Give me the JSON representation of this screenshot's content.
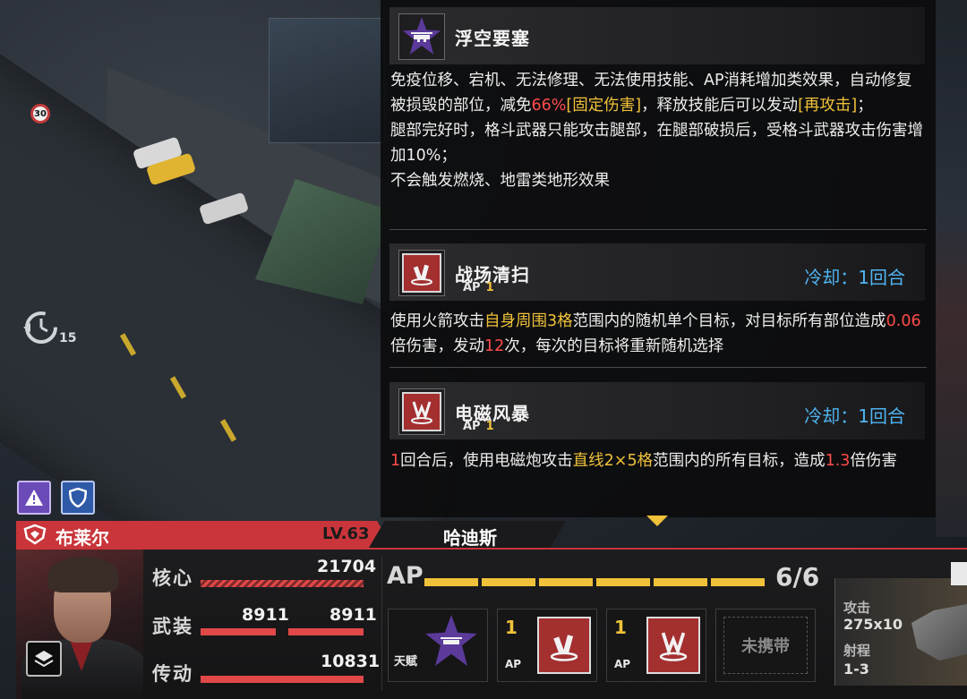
{
  "tooltip": {
    "skill1": {
      "name": "浮空要塞",
      "desc": [
        {
          "t": "免疫位移、宕机、无法修理、无法使用技能、AP消耗增加类效果，自动修复被损毁的部位，减免",
          "c": ""
        },
        {
          "t": "66%",
          "c": "red"
        },
        {
          "t": "[固定伤害]",
          "c": "yel"
        },
        {
          "t": "，释放技能后可以发动",
          "c": ""
        },
        {
          "t": "[再攻击]",
          "c": "yel"
        },
        {
          "t": "；",
          "c": ""
        },
        {
          "t": "\n腿部完好时，格斗武器只能攻击腿部，在腿部破损后，受格斗武器攻击伤害增加10%；",
          "c": ""
        },
        {
          "t": "\n不会触发燃烧、地雷类地形效果",
          "c": ""
        }
      ]
    },
    "skill2": {
      "name": "战场清扫",
      "ap_label": "AP",
      "ap_value": "1",
      "cooldown": "冷却：1回合",
      "desc": [
        {
          "t": "使用火箭攻击",
          "c": ""
        },
        {
          "t": "自身周围3格",
          "c": "yel"
        },
        {
          "t": "范围内的随机单个目标，对目标所有部位造成",
          "c": ""
        },
        {
          "t": "0.06",
          "c": "red"
        },
        {
          "t": "倍伤害，发动",
          "c": ""
        },
        {
          "t": "12",
          "c": "red"
        },
        {
          "t": "次，每次的目标将重新随机选择",
          "c": ""
        }
      ]
    },
    "skill3": {
      "name": "电磁风暴",
      "ap_label": "AP",
      "ap_value": "1",
      "cooldown": "冷却：1回合",
      "desc": [
        {
          "t": "1",
          "c": "red"
        },
        {
          "t": "回合后，使用电磁炮攻击",
          "c": ""
        },
        {
          "t": "直线2×5格",
          "c": "yel"
        },
        {
          "t": "范围内的所有目标，造成",
          "c": ""
        },
        {
          "t": "1.3",
          "c": "red"
        },
        {
          "t": "倍伤害",
          "c": ""
        }
      ]
    }
  },
  "scene": {
    "speed_sign": "30",
    "timer_value": "15"
  },
  "unit": {
    "pilot_name": "布莱尔",
    "level": "LV.63",
    "mech_name": "哈迪斯",
    "stats": {
      "core_label": "核心",
      "core_value": "21704",
      "armor_label": "武装",
      "armor_left": "8911",
      "armor_right": "8911",
      "drive_label": "传动",
      "drive_value": "10831"
    },
    "ap": {
      "label": "AP",
      "count": "6/6",
      "current": 6,
      "max": 6
    },
    "slots": [
      {
        "label": "天赋",
        "ap": ""
      },
      {
        "label": "AP",
        "ap": "1"
      },
      {
        "label": "AP",
        "ap": "1"
      },
      {
        "label": "未携带",
        "ap": ""
      }
    ],
    "weapon": {
      "attack_label": "攻击",
      "attack_value": "275x10",
      "range_label": "射程",
      "range_value": "1-3"
    }
  },
  "colors": {
    "accent_red": "#c9353a",
    "highlight_red": "#ff4b4b",
    "highlight_yellow": "#f0c23a",
    "cooldown_blue": "#4fb4f2",
    "talent_purple": "#5b3a9a"
  }
}
